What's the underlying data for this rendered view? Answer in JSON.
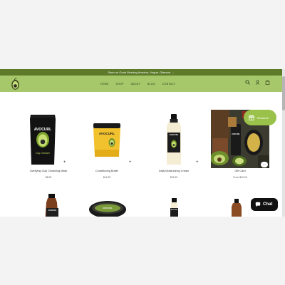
{
  "announcement": "Seen on Good Morning America, Vogue, Glamour",
  "announcement_arrow": "→",
  "nav": {
    "items": [
      "HOME",
      "SHOP",
      "ABOUT",
      "BLOG",
      "CONTACT"
    ]
  },
  "products": [
    {
      "name": "Clarifying Clay Cleansing Mask",
      "price": "$8.99",
      "brand": "AVOCURL",
      "subtitle": "Clay Cleanser"
    },
    {
      "name": "Conditioning Butter",
      "price": "$14.99",
      "brand": "AVOCURL",
      "subtitle": ""
    },
    {
      "name": "Daily Moisturizing Cream",
      "price": "$21.99",
      "brand": "AVOCURL",
      "subtitle": ""
    },
    {
      "name": "Gift Card",
      "price": "From $10.00",
      "brand": "AVOCURL",
      "subtitle": ""
    }
  ],
  "row2_brand": "AVOCURL",
  "rewards_label": "Rewards",
  "chat_label": "Chat",
  "gift_badge": "...",
  "colors": {
    "announcement_bg": "#5c7a2a",
    "header_bg": "#a6c76a",
    "rewards_bg": "#9ac24a",
    "chat_bg": "#111111"
  },
  "icons": {
    "header": [
      "search-icon",
      "account-icon",
      "cart-icon"
    ],
    "rewards": "gift-icon",
    "chat": "chat-bubble-icon"
  }
}
